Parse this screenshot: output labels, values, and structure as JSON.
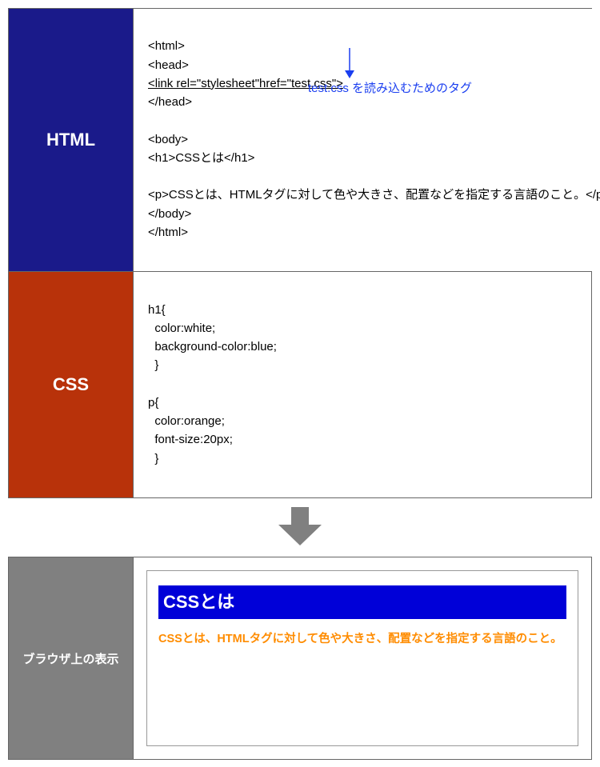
{
  "panels": {
    "html": {
      "label": "HTML",
      "code_lines": [
        "<html>",
        "<head>",
        "<link rel=\"stylesheet\"href=\"test.css\">",
        "</head>",
        "",
        "<body>",
        "<h1>CSSとは</h1>",
        "",
        "<p>CSSとは、HTMLタグに対して色や大きさ、配置などを指定する言語のこと。</p>",
        "</body>",
        "</html>"
      ],
      "annotation": "test.css を読み込むためのタグ"
    },
    "css": {
      "label": "CSS",
      "code_lines": [
        "h1{",
        "  color:white;",
        "  background-color:blue;",
        "  }",
        "",
        "p{",
        "  color:orange;",
        "  font-size:20px;",
        "  }"
      ]
    },
    "browser": {
      "label": "ブラウザ上の表示",
      "rendered_h1": "CSSとは",
      "rendered_p": "CSSとは、HTMLタグに対して色や大きさ、配置などを指定する言語のこと。"
    }
  }
}
